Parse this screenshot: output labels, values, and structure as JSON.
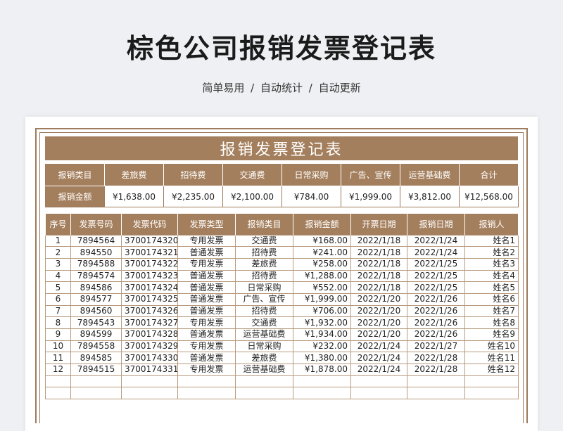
{
  "page": {
    "title": "棕色公司报销发票登记表",
    "subtitle": "简单易用 / 自动统计 / 自动更新"
  },
  "sheet": {
    "title": "报销发票登记表",
    "summary": {
      "row_label_category": "报销类目",
      "row_label_amount": "报销金额",
      "categories": [
        "差旅费",
        "招待费",
        "交通费",
        "日常采购",
        "广告、宣传",
        "运营基础费",
        "合计"
      ],
      "amounts": [
        "¥1,638.00",
        "¥2,235.00",
        "¥2,100.00",
        "¥784.00",
        "¥1,999.00",
        "¥3,812.00",
        "¥12,568.00"
      ]
    },
    "columns": [
      "序号",
      "发票号码",
      "发票代码",
      "发票类型",
      "报销类目",
      "报销金额",
      "开票日期",
      "报销日期",
      "报销人"
    ],
    "rows": [
      [
        "1",
        "7894564",
        "3700174320",
        "专用发票",
        "交通费",
        "¥168.00",
        "2022/1/18",
        "2022/1/24",
        "姓名1"
      ],
      [
        "2",
        "894550",
        "3700174321",
        "普通发票",
        "招待费",
        "¥241.00",
        "2022/1/18",
        "2022/1/24",
        "姓名2"
      ],
      [
        "3",
        "7894588",
        "3700174322",
        "专用发票",
        "差旅费",
        "¥258.00",
        "2022/1/18",
        "2022/1/25",
        "姓名3"
      ],
      [
        "4",
        "7894574",
        "3700174323",
        "普通发票",
        "招待费",
        "¥1,288.00",
        "2022/1/18",
        "2022/1/25",
        "姓名4"
      ],
      [
        "5",
        "894586",
        "3700174324",
        "普通发票",
        "日常采购",
        "¥552.00",
        "2022/1/18",
        "2022/1/25",
        "姓名5"
      ],
      [
        "6",
        "894577",
        "3700174325",
        "普通发票",
        "广告、宣传",
        "¥1,999.00",
        "2022/1/20",
        "2022/1/26",
        "姓名6"
      ],
      [
        "7",
        "894560",
        "3700174326",
        "普通发票",
        "招待费",
        "¥706.00",
        "2022/1/20",
        "2022/1/26",
        "姓名7"
      ],
      [
        "8",
        "7894543",
        "3700174327",
        "专用发票",
        "交通费",
        "¥1,932.00",
        "2022/1/20",
        "2022/1/26",
        "姓名8"
      ],
      [
        "9",
        "894599",
        "3700174328",
        "普通发票",
        "运营基础费",
        "¥1,934.00",
        "2022/1/20",
        "2022/1/26",
        "姓名9"
      ],
      [
        "10",
        "7894558",
        "3700174329",
        "专用发票",
        "日常采购",
        "¥232.00",
        "2022/1/24",
        "2022/1/27",
        "姓名10"
      ],
      [
        "11",
        "894585",
        "3700174330",
        "普通发票",
        "差旅费",
        "¥1,380.00",
        "2022/1/24",
        "2022/1/28",
        "姓名11"
      ],
      [
        "12",
        "7894515",
        "3700174331",
        "专用发票",
        "运营基础费",
        "¥1,878.00",
        "2022/1/24",
        "2022/1/28",
        "姓名12"
      ],
      [
        "",
        "",
        "",
        "",
        "",
        "",
        "",
        "",
        ""
      ],
      [
        "",
        "",
        "",
        "",
        "",
        "",
        "",
        "",
        ""
      ]
    ]
  },
  "colors": {
    "accent": "#a47f5d",
    "border": "#9e7b5c",
    "background": "#eef0f3"
  }
}
